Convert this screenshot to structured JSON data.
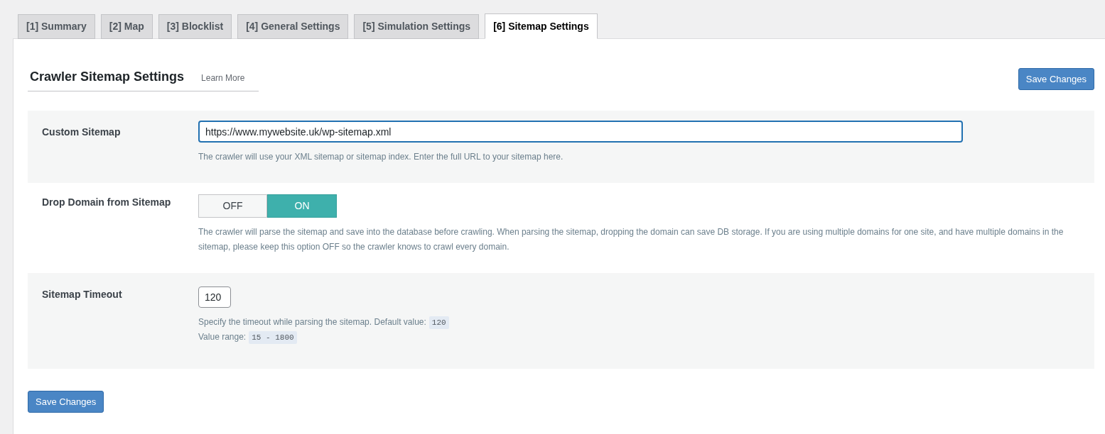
{
  "tabs": [
    {
      "label": "[1] Summary",
      "selected": false
    },
    {
      "label": "[2] Map",
      "selected": false
    },
    {
      "label": "[3] Blocklist",
      "selected": false
    },
    {
      "label": "[4] General Settings",
      "selected": false
    },
    {
      "label": "[5] Simulation Settings",
      "selected": false
    },
    {
      "label": "[6] Sitemap Settings",
      "selected": true
    }
  ],
  "heading": {
    "title": "Crawler Sitemap Settings",
    "link": "Learn More"
  },
  "top_button": "Save Changes",
  "settings": [
    {
      "kind": "text",
      "label": "Custom Sitemap",
      "value": "https://www.mywebsite.uk/wp-sitemap.xml",
      "description": [
        {
          "text": "The crawler will use your XML sitemap or sitemap index. Enter the full URL to your sitemap here."
        }
      ]
    },
    {
      "kind": "toggle",
      "label": "Drop Domain from Sitemap",
      "options": [
        {
          "label": "OFF",
          "selected": false
        },
        {
          "label": "ON",
          "selected": true
        }
      ],
      "description": [
        {
          "text": "The crawler will parse the sitemap and save into the database before crawling. When parsing the sitemap, dropping the domain can save DB storage. If you are using multiple domains for one site, and have multiple domains in the sitemap, please keep this option OFF so the crawler knows to crawl every domain."
        }
      ]
    },
    {
      "kind": "number",
      "label": "Sitemap Timeout",
      "value": "120",
      "description": [
        {
          "text": "Specify the timeout while parsing the sitemap. Default value:",
          "code": "120"
        },
        {
          "text": "Value range:",
          "code": "15 - 1800"
        }
      ]
    }
  ],
  "bottom_button": "Save Changes"
}
